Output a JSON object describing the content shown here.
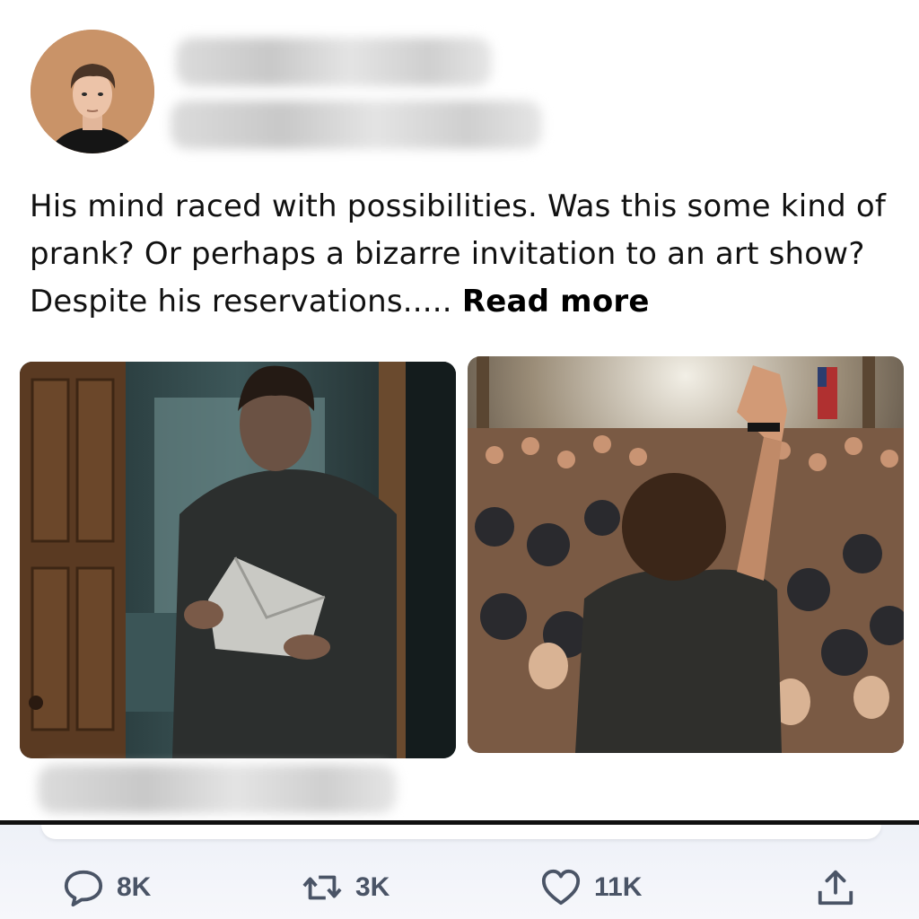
{
  "post": {
    "text_main": "His mind raced with possibilities. Was this some kind of prank? Or perhaps a bizarre invitation to an art show? Despite his reservations.....",
    "read_more_label": "Read more"
  },
  "actions": {
    "reply_count": "8K",
    "repost_count": "3K",
    "like_count": "11K"
  },
  "icons": {
    "reply": "speech-bubble-icon",
    "repost": "repost-arrows-icon",
    "like": "heart-icon",
    "share": "share-upload-icon"
  },
  "colors": {
    "action_gray": "#4a5466",
    "text": "#111111",
    "divider": "#111111"
  }
}
